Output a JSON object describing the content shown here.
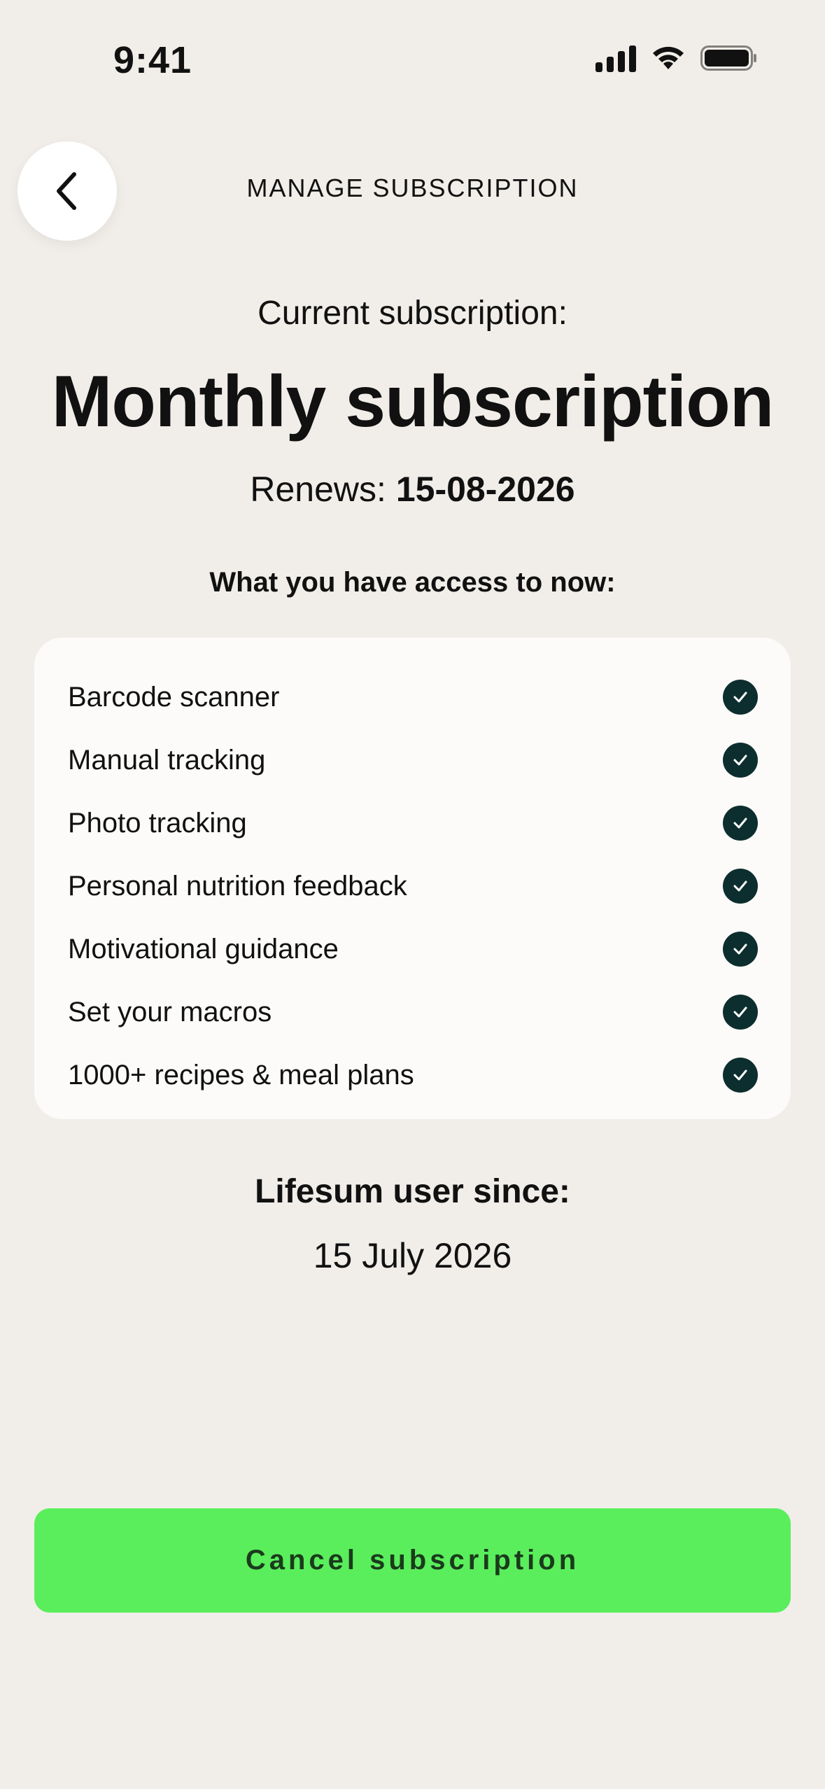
{
  "status_bar": {
    "time": "9:41"
  },
  "header": {
    "title": "MANAGE SUBSCRIPTION",
    "back_icon": "chevron-left-icon"
  },
  "subscription": {
    "current_label": "Current subscription:",
    "plan_name": "Monthly subscription",
    "renews_label": "Renews:",
    "renews_date": "15-08-2026"
  },
  "access": {
    "heading": "What you have access to now:",
    "features": [
      {
        "label": "Barcode scanner",
        "icon": "check-circle-icon"
      },
      {
        "label": "Manual tracking",
        "icon": "check-circle-icon"
      },
      {
        "label": "Photo tracking",
        "icon": "check-circle-icon"
      },
      {
        "label": "Personal nutrition feedback",
        "icon": "check-circle-icon"
      },
      {
        "label": "Motivational guidance",
        "icon": "check-circle-icon"
      },
      {
        "label": "Set your macros",
        "icon": "check-circle-icon"
      },
      {
        "label": "1000+ recipes & meal plans",
        "icon": "check-circle-icon"
      }
    ]
  },
  "member": {
    "since_label": "Lifesum user since:",
    "since_date": "15 July 2026"
  },
  "actions": {
    "cancel_label": "Cancel subscription"
  },
  "colors": {
    "background": "#f1eee9",
    "card": "#fcfbf9",
    "check": "#0d2e2e",
    "cancel_button": "#5aee5c",
    "cancel_text": "#1b3a1c"
  }
}
